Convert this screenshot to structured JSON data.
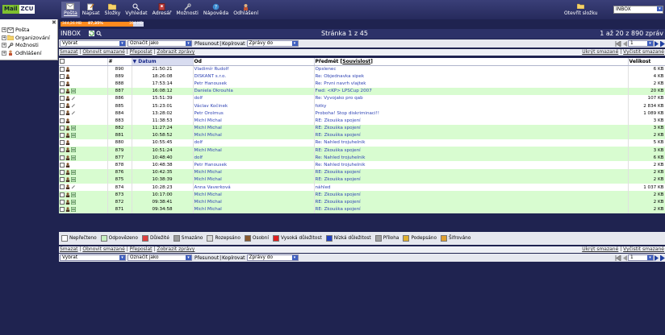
{
  "logo": {
    "part1": "Mail",
    "part2": "ZCU"
  },
  "nav": [
    {
      "label": "Pošta",
      "icon": "mail-icon",
      "active": true
    },
    {
      "label": "Napsat",
      "icon": "compose-icon",
      "active": false
    },
    {
      "label": "Složky",
      "icon": "folders-icon",
      "active": false
    },
    {
      "label": "Vyhledat",
      "icon": "search-icon",
      "active": false
    },
    {
      "label": "Adresář",
      "icon": "addressbook-icon",
      "active": false
    },
    {
      "label": "Možnosti",
      "icon": "options-icon",
      "active": false
    },
    {
      "label": "Nápověda",
      "icon": "help-icon",
      "active": false
    },
    {
      "label": "Odhlášení",
      "icon": "logout-icon",
      "active": false
    }
  ],
  "open_folder_label": "Otevřít složku",
  "folder_select_value": "INBOX",
  "sidebar": {
    "items": [
      {
        "label": "Pošta",
        "icon": "mail-folder-icon"
      },
      {
        "label": "Organizování",
        "icon": "organize-icon"
      },
      {
        "label": "Možnosti",
        "icon": "options-icon"
      },
      {
        "label": "Odhlášení",
        "icon": "logout-icon"
      }
    ]
  },
  "quota": {
    "left_text": "344,26 MB",
    "mid_text": "87,35%",
    "right_text": "394 MB",
    "fraction": 0.8735
  },
  "title": {
    "folder": "INBOX",
    "page": "Stránka 1 z 45",
    "range": "1 až 20 z 890 zpráv"
  },
  "toolbar": {
    "select_value": "Vybrat",
    "mark_value": "Označit jako",
    "move_label": "Přesunout",
    "copy_label": "Kopírovat",
    "target_value": "Zprávy do",
    "page_value": "1"
  },
  "links": {
    "delete": "Smazat",
    "undelete": "Obnovit smazané",
    "forward": "Přeposlat",
    "show": "Zobrazit zprávy",
    "hide_deleted": "Ukrýt smazané",
    "purge": "Vyčistit smazané"
  },
  "table": {
    "headers": {
      "num": "#",
      "date": "Datum",
      "from": "Od",
      "subject": "Předmět",
      "thread": "Souvislost",
      "size": "Velikost"
    },
    "rows": [
      {
        "num": "890",
        "date": "21:50:21",
        "from": "Vladimír Rudolf",
        "subject": "Opslenec",
        "size": "6 KB",
        "read": false
      },
      {
        "num": "889",
        "date": "18:26:08",
        "from": "DISKANT s.r.o.",
        "subject": "Re: Objednavka sipek",
        "size": "4 KB",
        "read": false
      },
      {
        "num": "888",
        "date": "17:53:14",
        "from": "Petr Hanousek",
        "subject": "Re: Prvni navrh vlajtek",
        "size": "2 KB",
        "read": false
      },
      {
        "num": "887",
        "date": "16:08:12",
        "from": "Daniela Okrouhla",
        "subject": "Fwd: <KP> LPSCup 2007",
        "size": "20 KB",
        "read": true
      },
      {
        "num": "886",
        "date": "15:51:39",
        "from": "dolf",
        "subject": "Re: Vyvojako pro qab",
        "size": "107 KB",
        "read": false
      },
      {
        "num": "885",
        "date": "15:23:01",
        "from": "Václav Kočinek",
        "subject": "fotky",
        "size": "2 834 KB",
        "read": false
      },
      {
        "num": "884",
        "date": "13:28:02",
        "from": "Petr Orolmus",
        "subject": "Proboha! Stop diskriminaci!!",
        "size": "1 089 KB",
        "read": false
      },
      {
        "num": "883",
        "date": "11:38:53",
        "from": "Michl Michal",
        "subject": "RE: Zkouška spojení",
        "size": "3 KB",
        "read": false
      },
      {
        "num": "882",
        "date": "11:27:24",
        "from": "Michl Michal",
        "subject": "RE: Zkouška spojení",
        "size": "3 KB",
        "read": true
      },
      {
        "num": "881",
        "date": "10:58:52",
        "from": "Michl Michal",
        "subject": "RE: Zkouška spojení",
        "size": "2 KB",
        "read": true
      },
      {
        "num": "880",
        "date": "10:55:45",
        "from": "dolf",
        "subject": "Re: Nahled trojuhelnik",
        "size": "5 KB",
        "read": false
      },
      {
        "num": "879",
        "date": "10:51:24",
        "from": "Michl Michal",
        "subject": "RE: Zkouška spojení",
        "size": "3 KB",
        "read": true
      },
      {
        "num": "877",
        "date": "10:48:40",
        "from": "dolf",
        "subject": "Re: Nahled trojuhelnik",
        "size": "6 KB",
        "read": true
      },
      {
        "num": "878",
        "date": "10:48:38",
        "from": "Petr Hanousek",
        "subject": "Re: Nahled trojuhelnik",
        "size": "2 KB",
        "read": false
      },
      {
        "num": "876",
        "date": "10:42:35",
        "from": "Michl Michal",
        "subject": "RE: Zkouška spojení",
        "size": "2 KB",
        "read": true
      },
      {
        "num": "875",
        "date": "10:38:39",
        "from": "Michl Michal",
        "subject": "RE: Zkouška spojení",
        "size": "2 KB",
        "read": true
      },
      {
        "num": "874",
        "date": "10:28:23",
        "from": "Anna Vaverková",
        "subject": "náhled",
        "size": "1 037 KB",
        "read": false
      },
      {
        "num": "873",
        "date": "10:17:00",
        "from": "Michl Michal",
        "subject": "RE: Zkouška spojení",
        "size": "2 KB",
        "read": true
      },
      {
        "num": "872",
        "date": "09:38:41",
        "from": "Michl Michal",
        "subject": "RE: Zkouška spojení",
        "size": "2 KB",
        "read": true
      },
      {
        "num": "871",
        "date": "09:34:58",
        "from": "Michl Michal",
        "subject": "RE: Zkouška spojení",
        "size": "2 KB",
        "read": true
      }
    ]
  },
  "legend": [
    {
      "label": "Nepřečteno",
      "color": "#ffffff"
    },
    {
      "label": "Odpovězeno",
      "color": "#c8f0c0"
    },
    {
      "label": "Důležité",
      "color": "#e04040"
    },
    {
      "label": "Smazáno",
      "color": "#9a9a9a"
    },
    {
      "label": "Rozepsáno",
      "color": "#d8d8d8"
    },
    {
      "label": "Osobní",
      "color": "#8a5a30"
    },
    {
      "label": "Vysoká důležitost",
      "color": "#e02020"
    },
    {
      "label": "Nízká důležitost",
      "color": "#2040c0"
    },
    {
      "label": "Příloha",
      "color": "#a0a0a0"
    },
    {
      "label": "Podepsáno",
      "color": "#e0b030"
    },
    {
      "label": "Šifrováno",
      "color": "#e0a030"
    }
  ]
}
